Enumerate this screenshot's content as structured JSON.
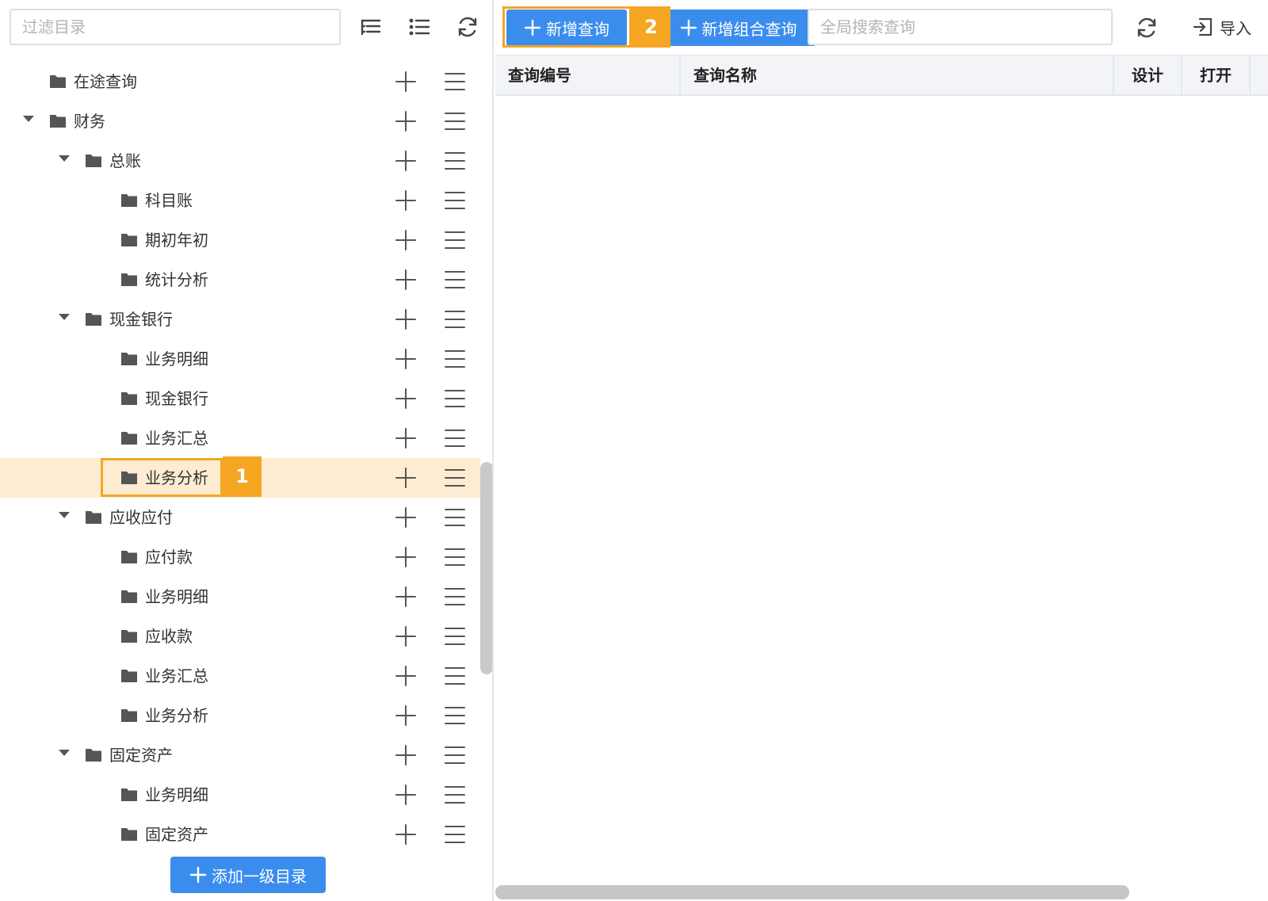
{
  "sidebar": {
    "filter_placeholder": "过滤目录",
    "toolbar_icons": [
      "expand-tree-icon",
      "list-icon",
      "refresh-icon"
    ],
    "add_top_level_label": "添加一级目录",
    "tree": [
      {
        "label": "在途查询",
        "level": 0,
        "expanded": null
      },
      {
        "label": "财务",
        "level": 0,
        "expanded": true
      },
      {
        "label": "总账",
        "level": 1,
        "expanded": true
      },
      {
        "label": "科目账",
        "level": 2,
        "expanded": null
      },
      {
        "label": "期初年初",
        "level": 2,
        "expanded": null
      },
      {
        "label": "统计分析",
        "level": 2,
        "expanded": null
      },
      {
        "label": "现金银行",
        "level": 1,
        "expanded": true
      },
      {
        "label": "业务明细",
        "level": 2,
        "expanded": null
      },
      {
        "label": "现金银行",
        "level": 2,
        "expanded": null
      },
      {
        "label": "业务汇总",
        "level": 2,
        "expanded": null
      },
      {
        "label": "业务分析",
        "level": 2,
        "expanded": null,
        "selected": true
      },
      {
        "label": "应收应付",
        "level": 1,
        "expanded": true
      },
      {
        "label": "应付款",
        "level": 2,
        "expanded": null
      },
      {
        "label": "业务明细",
        "level": 2,
        "expanded": null
      },
      {
        "label": "应收款",
        "level": 2,
        "expanded": null
      },
      {
        "label": "业务汇总",
        "level": 2,
        "expanded": null
      },
      {
        "label": "业务分析",
        "level": 2,
        "expanded": null
      },
      {
        "label": "固定资产",
        "level": 1,
        "expanded": true
      },
      {
        "label": "业务明细",
        "level": 2,
        "expanded": null
      },
      {
        "label": "固定资产",
        "level": 2,
        "expanded": null
      }
    ]
  },
  "toolbar": {
    "new_query_label": "新增查询",
    "new_combo_query_label": "新增组合查询",
    "search_placeholder": "全局搜索查询",
    "import_label": "导入"
  },
  "table": {
    "columns": [
      "查询编号",
      "查询名称",
      "设计",
      "打开"
    ],
    "rows": []
  },
  "annotations": {
    "badge_1": "1",
    "badge_2": "2"
  },
  "colors": {
    "primary": "#3b8ded",
    "highlight": "#f5a623",
    "selected_row": "#fdecd2"
  }
}
